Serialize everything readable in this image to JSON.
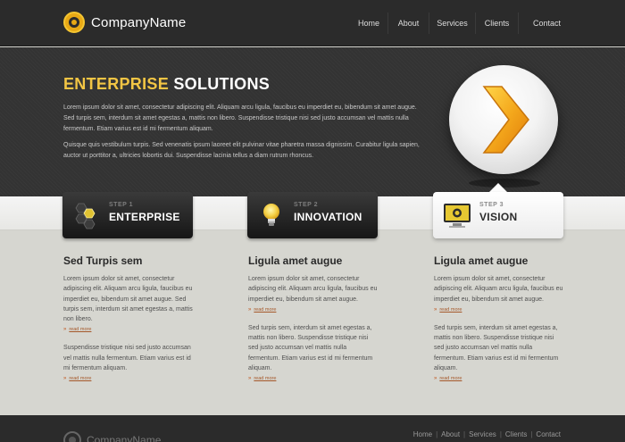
{
  "header": {
    "logo_text": "CompanyName",
    "nav": [
      "Home",
      "About",
      "Services",
      "Clients",
      "Contact"
    ]
  },
  "hero": {
    "title_highlight": "ENTERPRISE",
    "title_rest": "SOLUTIONS",
    "paragraph1": "Lorem ipsum dolor sit amet, consectetur adipiscing elit. Aliquam arcu ligula, faucibus eu imperdiet eu, bibendum sit amet augue. Sed turpis sem, interdum sit amet egestas a, mattis non libero. Suspendisse tristique nisi sed justo accumsan vel mattis nulla fermentum. Etiam varius est id mi fermentum aliquam.",
    "paragraph2": "Quisque quis vestibulum turpis. Sed venenatis ipsum laoreet elit pulvinar vitae pharetra massa dignissim. Curabitur ligula sapien, auctor ut porttitor a, ultricies lobortis dui. Suspendisse lacinia tellus a diam rutrum rhoncus.",
    "orb_icon": "chevron-right-icon"
  },
  "steps": [
    {
      "num": "STEP 1",
      "label": "ENTERPRISE",
      "icon": "hexagon-icon"
    },
    {
      "num": "STEP 2",
      "label": "INNOVATION",
      "icon": "lightbulb-icon"
    },
    {
      "num": "STEP 3",
      "label": "VISION",
      "icon": "monitor-icon"
    }
  ],
  "columns": [
    {
      "title": "Sed Turpis sem",
      "text1": "Lorem ipsum dolor sit amet, consectetur adipiscing elit. Aliquam arcu ligula, faucibus eu imperdiet eu, bibendum sit amet augue. Sed turpis sem, interdum sit amet egestas a, mattis non libero.",
      "more1": "read more",
      "text2": "Suspendisse tristique nisi sed justo accumsan vel mattis nulla fermentum. Etiam varius est id mi fermentum aliquam.",
      "more2": "read more"
    },
    {
      "title": "Ligula amet augue",
      "text1": "Lorem ipsum dolor sit amet, consectetur adipiscing elit. Aliquam arcu ligula, faucibus eu imperdiet eu, bibendum sit amet augue.",
      "more1": "read more",
      "text2": "Sed turpis sem, interdum sit amet egestas a, mattis non libero. Suspendisse tristique nisi sed justo accumsan vel mattis nulla fermentum. Etiam varius est id mi fermentum aliquam.",
      "more2": "read more"
    },
    {
      "title": "Ligula amet augue",
      "text1": "Lorem ipsum dolor sit amet, consectetur adipiscing elit. Aliquam arcu ligula, faucibus eu imperdiet eu, bibendum sit amet augue.",
      "more1": "read more",
      "text2": "Sed turpis sem, interdum sit amet egestas a, mattis non libero. Suspendisse tristique nisi sed justo accumsan vel mattis nulla fermentum. Etiam varius est id mi fermentum aliquam.",
      "more2": "read more"
    }
  ],
  "footer": {
    "logo_text": "CompanyName",
    "nav": [
      "Home",
      "About",
      "Services",
      "Clients",
      "Contact"
    ]
  },
  "colors": {
    "accent": "#f2c544",
    "dark": "#2b2b2b",
    "link": "#c0541a"
  }
}
